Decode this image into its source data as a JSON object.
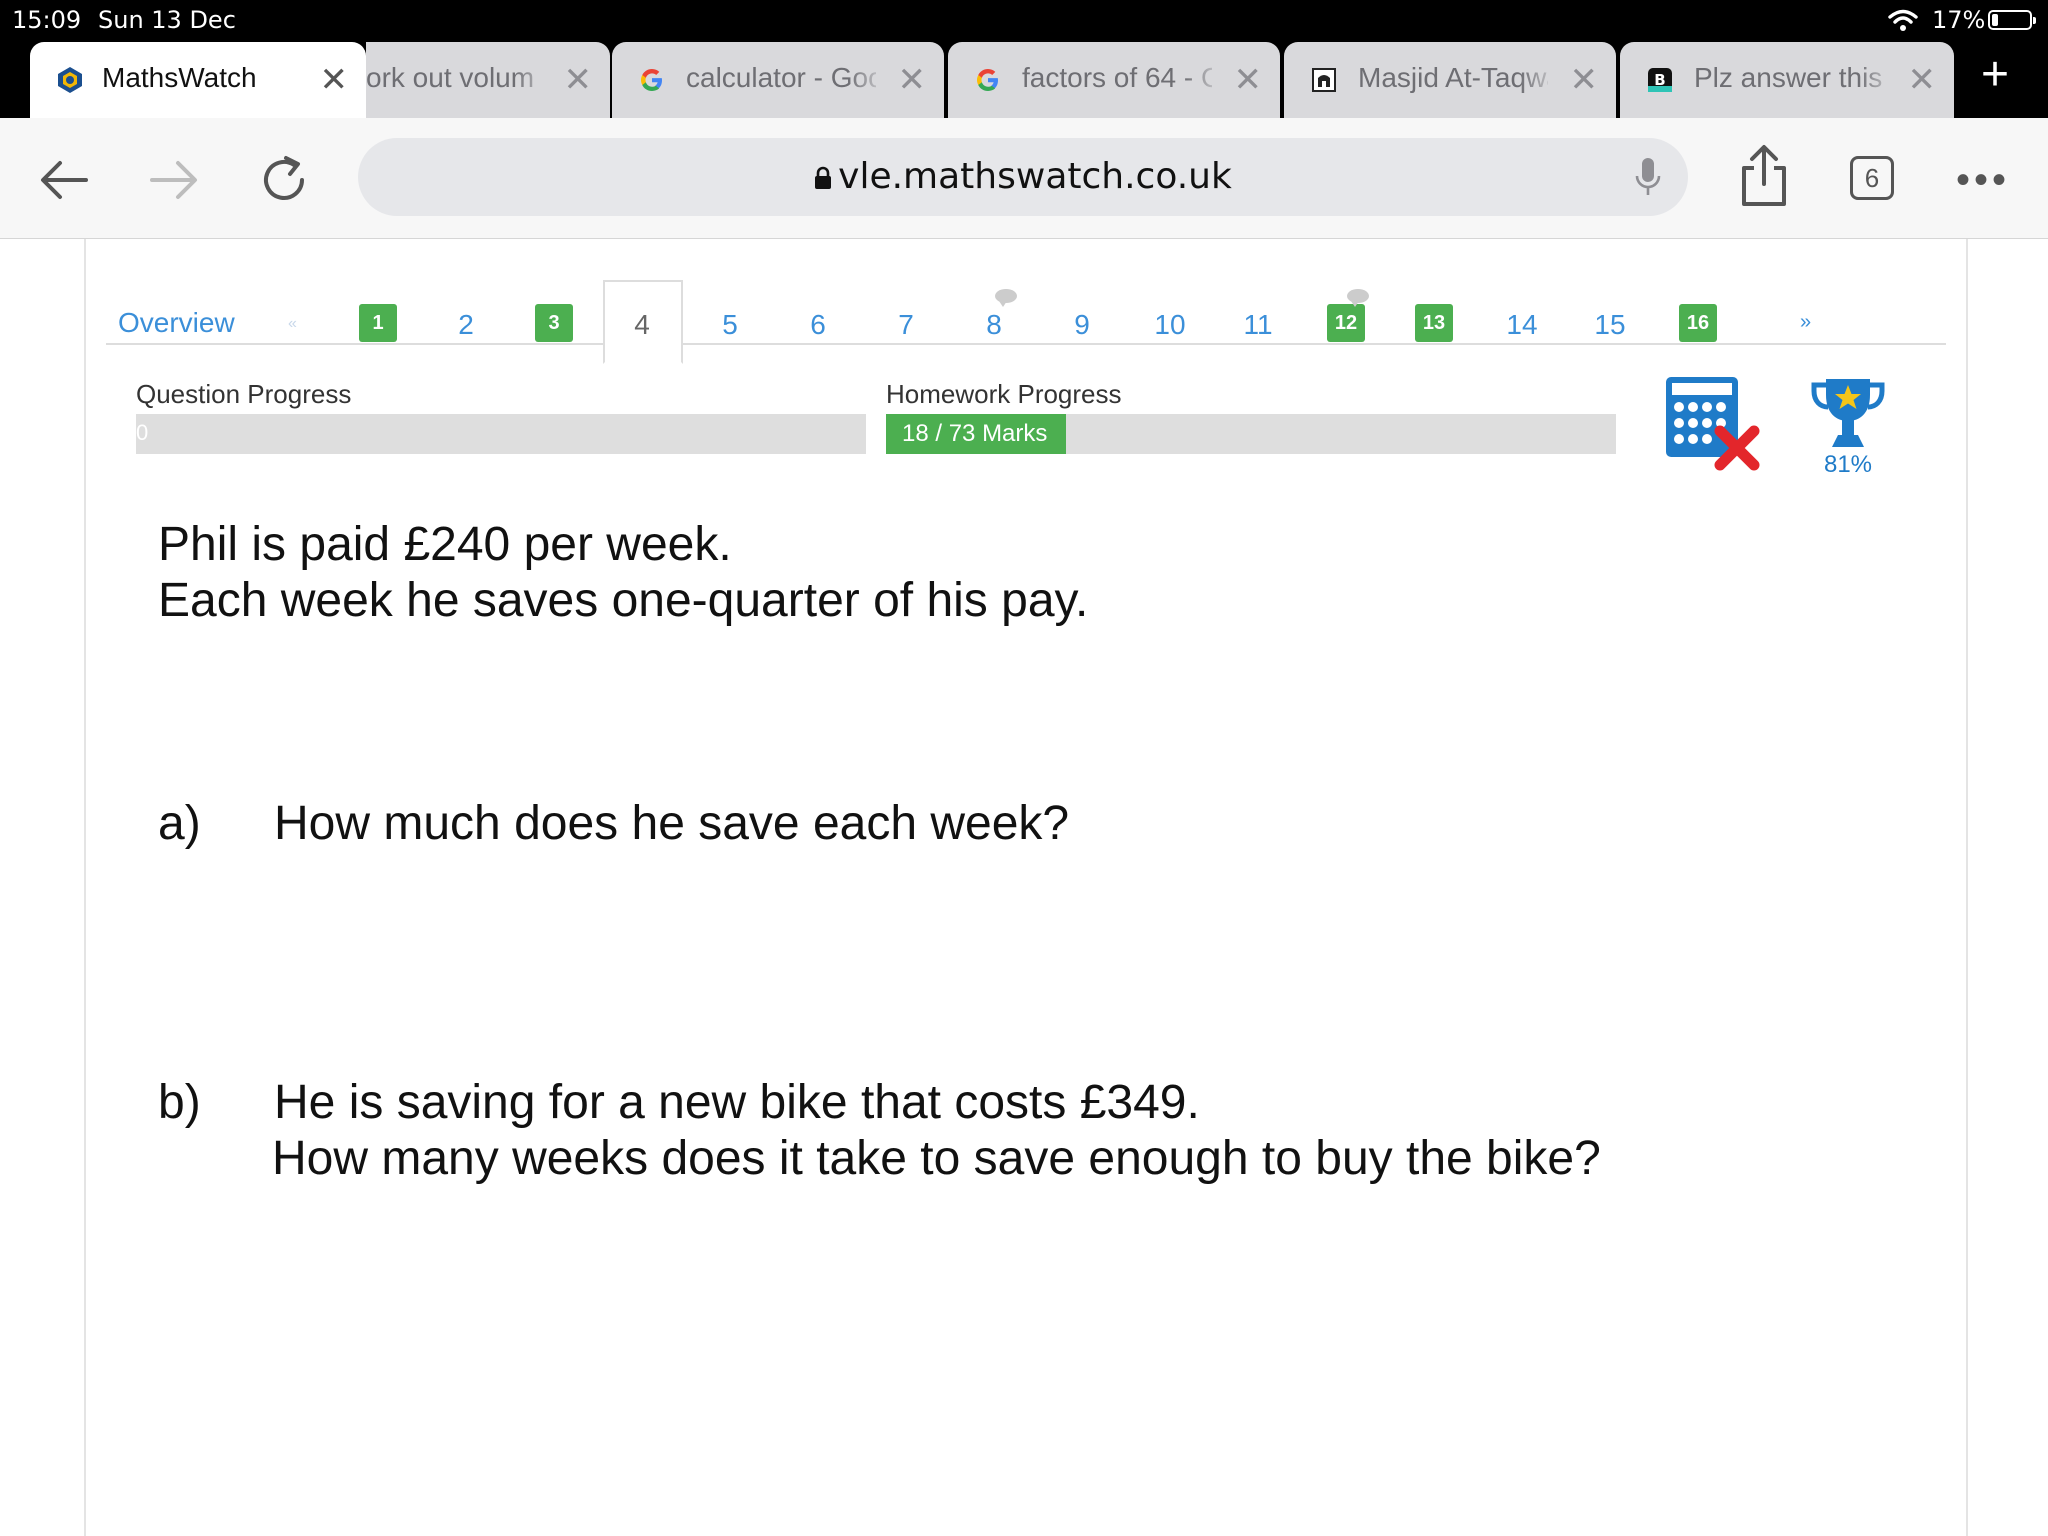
{
  "status": {
    "time": "15:09",
    "date": "Sun 13 Dec",
    "battery": "17%",
    "battery_level": 0.17
  },
  "tabs": [
    {
      "label": "MathsWatch",
      "active": true
    },
    {
      "label": "ork out volum",
      "active": false
    },
    {
      "label": "calculator - Goo",
      "active": false
    },
    {
      "label": "factors of 64 - G",
      "active": false
    },
    {
      "label": "Masjid At-Taqwa",
      "active": false
    },
    {
      "label": "Plz answer this",
      "active": false
    }
  ],
  "toolbar": {
    "url": "vle.mathswatch.co.uk",
    "tab_count": "6"
  },
  "question_nav": {
    "overview": "Overview",
    "first": "«",
    "next": "»",
    "current": "4",
    "questions": [
      "1",
      "2",
      "3",
      "4",
      "5",
      "6",
      "7",
      "8",
      "9",
      "10",
      "11",
      "12",
      "13",
      "14",
      "15",
      "16"
    ],
    "completed": [
      "1",
      "3",
      "12",
      "13",
      "16"
    ]
  },
  "progress": {
    "question_label": "Question Progress",
    "question_value": "0",
    "question_fraction": 0,
    "homework_label": "Homework Progress",
    "homework_value": "18 / 73 Marks",
    "homework_fraction": 0.2466
  },
  "score": {
    "percent": "81%"
  },
  "question": {
    "intro_line1": "Phil is paid £240 per week.",
    "intro_line2": "Each week he saves one-quarter of his pay.",
    "a_label": "a)",
    "a_text": "How much does he save each week?",
    "b_label": "b)",
    "b_line1": "He is saving for a new bike that costs £349.",
    "b_line2": "How many weeks does it take to save enough to buy the bike?"
  }
}
